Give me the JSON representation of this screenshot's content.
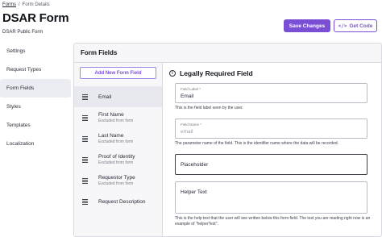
{
  "breadcrumb": {
    "link": "Forms",
    "separator": "/",
    "current": "Form Details"
  },
  "page": {
    "title": "DSAR Form",
    "subtitle": "DSAR Public Form"
  },
  "actions": {
    "save_label": "Save Changes",
    "code_icon": "</>",
    "code_label": "Get Code"
  },
  "sidebar": {
    "items": [
      {
        "label": "Settings"
      },
      {
        "label": "Request Types"
      },
      {
        "label": "Form Fields"
      },
      {
        "label": "Styles"
      },
      {
        "label": "Templates"
      },
      {
        "label": "Localization"
      }
    ],
    "active": "Form Fields"
  },
  "panel": {
    "title": "Form Fields"
  },
  "field_list": {
    "add_label": "Add New Form Field",
    "items": [
      {
        "label": "Email",
        "sub": ""
      },
      {
        "label": "First Name",
        "sub": "Excluded from form"
      },
      {
        "label": "Last Name",
        "sub": "Excluded from form"
      },
      {
        "label": "Proof of Identity",
        "sub": "Excluded from form"
      },
      {
        "label": "Requestor Type",
        "sub": "Excluded from form"
      },
      {
        "label": "Request Description",
        "sub": ""
      }
    ]
  },
  "detail": {
    "icon": "i",
    "title": "Legally Required Field",
    "field_label": {
      "label": "Field Label *",
      "value": "Email",
      "help": "This is the field label seen by the user."
    },
    "field_name": {
      "label": "Field Name *",
      "value": "email",
      "help": "The parameter name of the field. This is the identifier name where the data will be recorded."
    },
    "placeholder": {
      "value": "Placeholder"
    },
    "helper_text": {
      "value": "Helper Text",
      "help": "This is the help text that the user will see written below this form field. The text you are reading right now is an example of \"helperText\"."
    }
  },
  "colors": {
    "accent": "#7a4fd6",
    "border": "#d8dae0",
    "active_bg": "#ecedf3"
  }
}
